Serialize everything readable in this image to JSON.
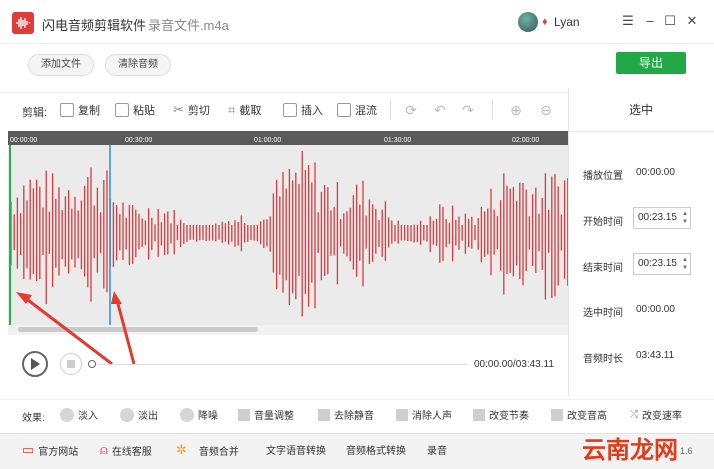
{
  "app": {
    "title": "闪电音频剪辑软件",
    "file_name": "- 录音文件.m4a",
    "user_name": "Lyan",
    "controls": {
      "minimize": "–",
      "restore": "☐",
      "close": "✕",
      "menu": "☰"
    }
  },
  "top_toolbar": {
    "add_file": "添加文件",
    "clear_audio": "清除音频",
    "export": "导出"
  },
  "edit_toolbar": {
    "label": "剪辑:",
    "copy": "复制",
    "paste": "粘贴",
    "cut": "剪切",
    "crop": "截取",
    "insert": "插入",
    "mix": "混流"
  },
  "timeline": {
    "ticks": [
      "00:00:00",
      "00:30:00",
      "01:00:00",
      "01:30:00",
      "02:00:00"
    ]
  },
  "selection_panel": {
    "title": "选中",
    "play_position_label": "播放位置",
    "play_position_value": "00:00.00",
    "start_time_label": "开始时间",
    "start_time_value": "00:23.15",
    "end_time_label": "结束时间",
    "end_time_value": "00:23.15",
    "selected_time_label": "选中时间",
    "selected_time_value": "00:00.00",
    "duration_label": "音频时长",
    "duration_value": "03:43.11"
  },
  "playback": {
    "time_readout": "00:00.00/03:43.11"
  },
  "effects": {
    "label": "效果:",
    "fade_in": "淡入",
    "fade_out": "淡出",
    "denoise": "降噪",
    "volume": "音量调整",
    "remove_silence": "去除静音",
    "remove_vocals": "消除人声",
    "change_tempo": "改变节奏",
    "change_pitch": "改变音高",
    "change_speed": "改变速率"
  },
  "bottom_bar": {
    "official_site": "官方网站",
    "support": "在线客服",
    "merge": "音频合并",
    "tts": "文字语音转换",
    "format_convert": "音频格式转换",
    "record": "录音",
    "version": "1.6",
    "watermark": "云南龙网"
  },
  "colors": {
    "accent": "#22a845",
    "waveform": "#d9393b",
    "annotation": "#e23b2f",
    "cursor_green": "#22b24c",
    "cursor_blue": "#2a8fd9"
  }
}
